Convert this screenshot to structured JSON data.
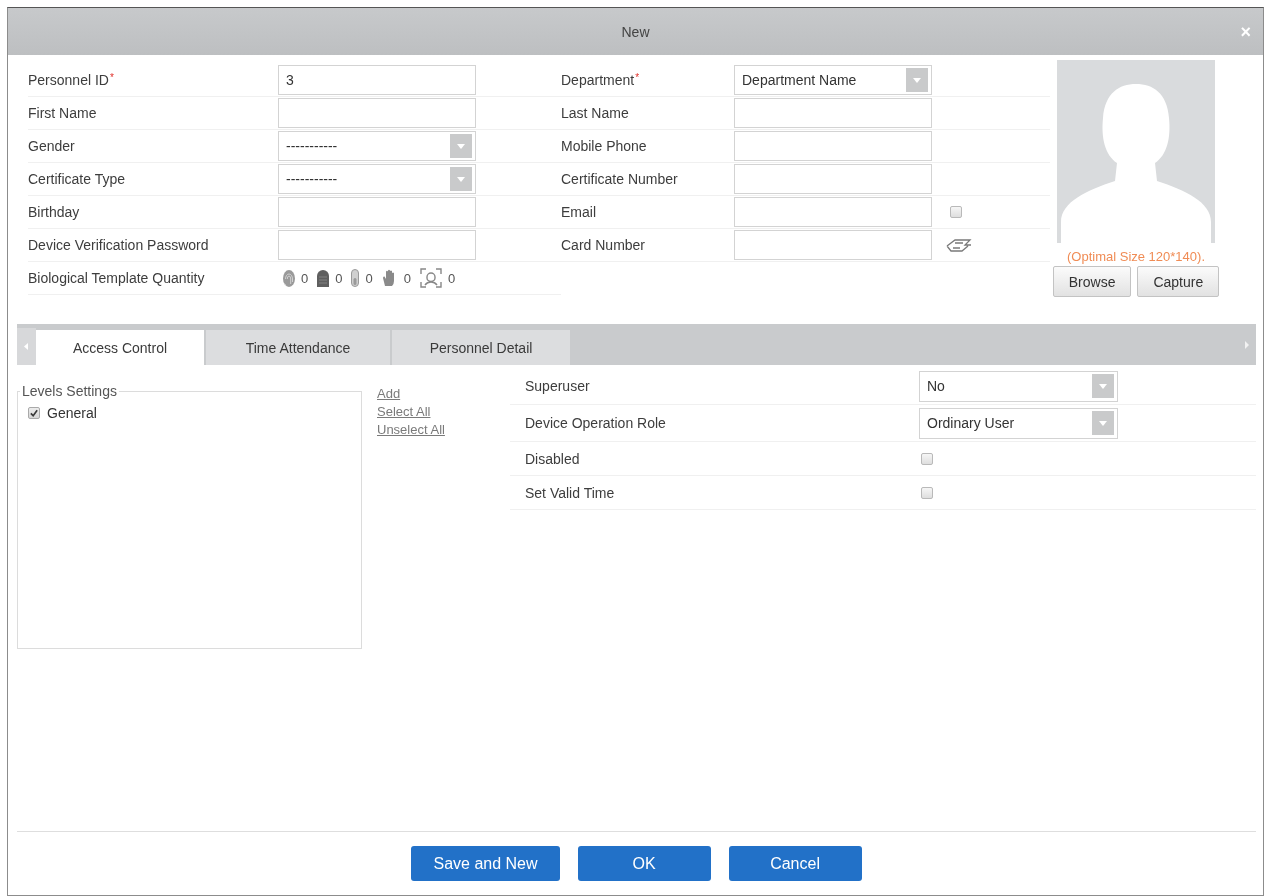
{
  "window": {
    "title": "New",
    "close_glyph": "×"
  },
  "personal_form": {
    "left_fields": [
      {
        "label": "Personnel ID",
        "required_mark": "*",
        "kind": "text",
        "value": "3"
      },
      {
        "label": "First Name",
        "kind": "text"
      },
      {
        "label": "Gender",
        "kind": "select",
        "value": "-----------"
      },
      {
        "label": "Certificate Type",
        "kind": "select",
        "value": "-----------"
      },
      {
        "label": "Birthday",
        "kind": "text"
      },
      {
        "label": "Device Verification Password",
        "kind": "text"
      },
      {
        "label": "Biological Template Quantity",
        "kind": "biometrics",
        "templates": [
          {
            "kind": "fingerprint",
            "count": "0"
          },
          {
            "kind": "fingertip",
            "count": "0"
          },
          {
            "kind": "finger",
            "count": "0"
          },
          {
            "kind": "palm",
            "count": "0"
          },
          {
            "kind": "face",
            "count": "0"
          }
        ]
      }
    ],
    "right_fields": [
      {
        "label": "Department",
        "required_mark": "*",
        "kind": "select",
        "value": "Department Name"
      },
      {
        "label": "Last Name",
        "kind": "text"
      },
      {
        "label": "Mobile Phone",
        "kind": "text"
      },
      {
        "label": "Certificate Number",
        "kind": "text"
      },
      {
        "label": "Email",
        "kind": "text",
        "extra": {
          "kind": "checkbox",
          "checked": false
        }
      },
      {
        "label": "Card Number",
        "kind": "text",
        "extra": {
          "kind": "card"
        }
      }
    ]
  },
  "photo": {
    "hint": "(Optimal Size 120*140).",
    "buttons": [
      "Browse",
      "Capture"
    ]
  },
  "tabs": [
    {
      "label": "Access Control",
      "selected": true
    },
    {
      "label": "Time Attendance",
      "selected": false
    },
    {
      "label": "Personnel Detail",
      "selected": false
    }
  ],
  "access_control": {
    "levels": {
      "legend": "Levels Settings",
      "items": [
        {
          "label": "General",
          "checked": true
        }
      ]
    },
    "links": [
      "Add",
      "Select All",
      "Unselect All"
    ],
    "settings": [
      {
        "label": "Superuser",
        "kind": "select",
        "value": "No"
      },
      {
        "label": "Device Operation Role",
        "kind": "select",
        "value": "Ordinary User"
      },
      {
        "label": "Disabled",
        "kind": "checkbox",
        "checked": false
      },
      {
        "label": "Set Valid Time",
        "kind": "checkbox",
        "checked": false
      }
    ]
  },
  "footer": {
    "buttons": [
      "Save and New",
      "OK",
      "Cancel"
    ]
  }
}
